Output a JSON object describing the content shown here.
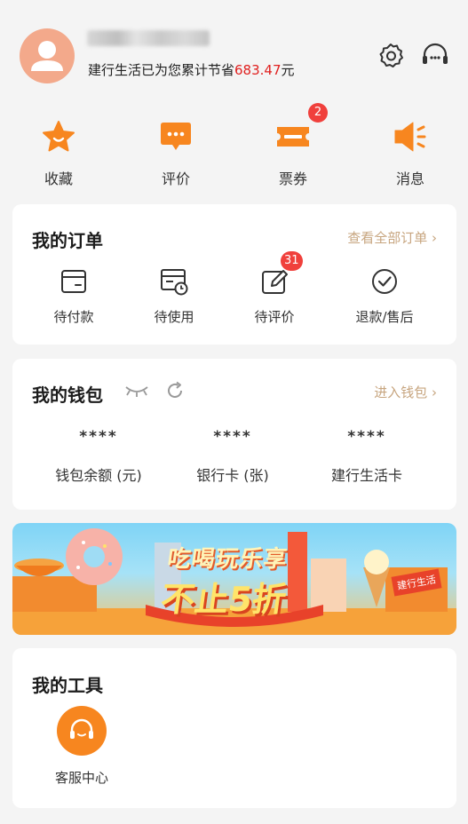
{
  "header": {
    "savings_prefix": "建行生活已为您累计节省",
    "savings_amount": "683.47",
    "savings_unit": "元"
  },
  "quick_actions": [
    {
      "label": "收藏",
      "icon": "star-icon"
    },
    {
      "label": "评价",
      "icon": "comment-icon"
    },
    {
      "label": "票券",
      "icon": "ticket-icon",
      "badge": "2"
    },
    {
      "label": "消息",
      "icon": "speaker-icon"
    }
  ],
  "orders": {
    "title": "我的订单",
    "link": "查看全部订单",
    "items": [
      {
        "label": "待付款",
        "icon": "wallet-outline-icon"
      },
      {
        "label": "待使用",
        "icon": "calendar-clock-icon"
      },
      {
        "label": "待评价",
        "icon": "edit-icon",
        "badge": "31"
      },
      {
        "label": "退款/售后",
        "icon": "check-circle-icon"
      }
    ]
  },
  "wallet": {
    "title": "我的钱包",
    "link": "进入钱包",
    "items": [
      {
        "value": "****",
        "label": "钱包余额 (元)"
      },
      {
        "value": "****",
        "label": "银行卡 (张)"
      },
      {
        "value": "****",
        "label": "建行生活卡"
      }
    ]
  },
  "banner": {
    "line1": "吃喝玩乐享",
    "line2": "不止5折",
    "sign": "建行生活"
  },
  "tools": {
    "title": "我的工具",
    "items": [
      {
        "label": "客服中心",
        "icon": "headset-icon"
      }
    ]
  },
  "colors": {
    "accent": "#f7861f",
    "price_red": "#e0201f",
    "link_gold": "#c7a57f",
    "badge_red": "#f0403c"
  }
}
